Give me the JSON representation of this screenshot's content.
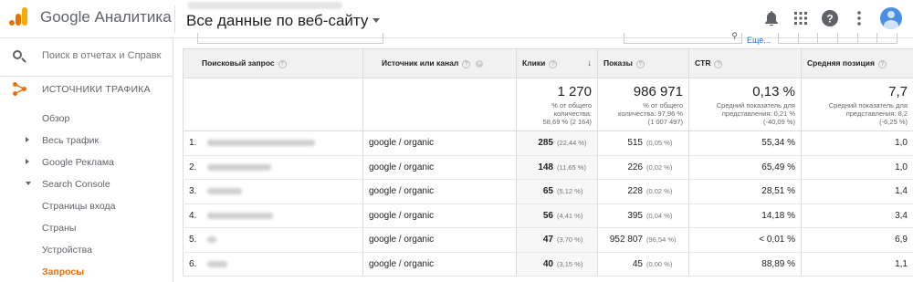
{
  "app": {
    "title": "Google Аналитика",
    "view_name": "Все данные по веб-сайту"
  },
  "sidebar": {
    "search_placeholder": "Поиск в отчетах и Справк",
    "section_label": "ИСТОЧНИКИ ТРАФИКА",
    "items": [
      {
        "label": "Обзор",
        "arrow": "none",
        "active": false
      },
      {
        "label": "Весь трафик",
        "arrow": "right",
        "active": false
      },
      {
        "label": "Google Реклама",
        "arrow": "right",
        "active": false
      },
      {
        "label": "Search Console",
        "arrow": "down",
        "active": false
      },
      {
        "label": "Страницы входа",
        "arrow": "none",
        "active": false
      },
      {
        "label": "Страны",
        "arrow": "none",
        "active": false
      },
      {
        "label": "Устройства",
        "arrow": "none",
        "active": false
      },
      {
        "label": "Запросы",
        "arrow": "none",
        "active": true
      }
    ]
  },
  "toolbar": {
    "link_label": "Еще..."
  },
  "table": {
    "headers": {
      "query": "Поисковый запрос",
      "source": "Источник или канал",
      "clicks": "Клики",
      "impressions": "Показы",
      "ctr": "CTR",
      "position": "Средняя позиция"
    },
    "totals": {
      "clicks": "1 270",
      "clicks_sub1": "% от общего",
      "clicks_sub2": "количества:",
      "clicks_sub3": "58,69 % (2 164)",
      "impressions": "986 971",
      "impressions_sub1": "% от общего",
      "impressions_sub2": "количества: 97,96 %",
      "impressions_sub3": "(1 007 497)",
      "ctr": "0,13 %",
      "ctr_sub1": "Средний показатель для",
      "ctr_sub2": "представления: 0,21 %",
      "ctr_sub3": "(-40,09 %)",
      "position": "7,7",
      "position_sub1": "Средний показатель для",
      "position_sub2": "представления: 8,2",
      "position_sub3": "(-6,25 %)"
    },
    "rows": [
      {
        "n": "1.",
        "source": "google / organic",
        "clicks": "285",
        "clicks_pct": "(22,44 %)",
        "impr": "515",
        "impr_pct": "(0,05 %)",
        "ctr": "55,34 %",
        "pos": "1,0"
      },
      {
        "n": "2.",
        "source": "google / organic",
        "clicks": "148",
        "clicks_pct": "(11,65 %)",
        "impr": "226",
        "impr_pct": "(0,02 %)",
        "ctr": "65,49 %",
        "pos": "1,0"
      },
      {
        "n": "3.",
        "source": "google / organic",
        "clicks": "65",
        "clicks_pct": "(5,12 %)",
        "impr": "228",
        "impr_pct": "(0,02 %)",
        "ctr": "28,51 %",
        "pos": "1,4"
      },
      {
        "n": "4.",
        "source": "google / organic",
        "clicks": "56",
        "clicks_pct": "(4,41 %)",
        "impr": "395",
        "impr_pct": "(0,04 %)",
        "ctr": "14,18 %",
        "pos": "3,4"
      },
      {
        "n": "5.",
        "source": "google / organic",
        "clicks": "47",
        "clicks_pct": "(3,70 %)",
        "impr": "952 807",
        "impr_pct": "(96,54 %)",
        "ctr": "< 0,01 %",
        "pos": "6,9"
      },
      {
        "n": "6.",
        "source": "google / organic",
        "clicks": "40",
        "clicks_pct": "(3,15 %)",
        "impr": "45",
        "impr_pct": "(0,00 %)",
        "ctr": "88,89 %",
        "pos": "1,1"
      }
    ]
  }
}
